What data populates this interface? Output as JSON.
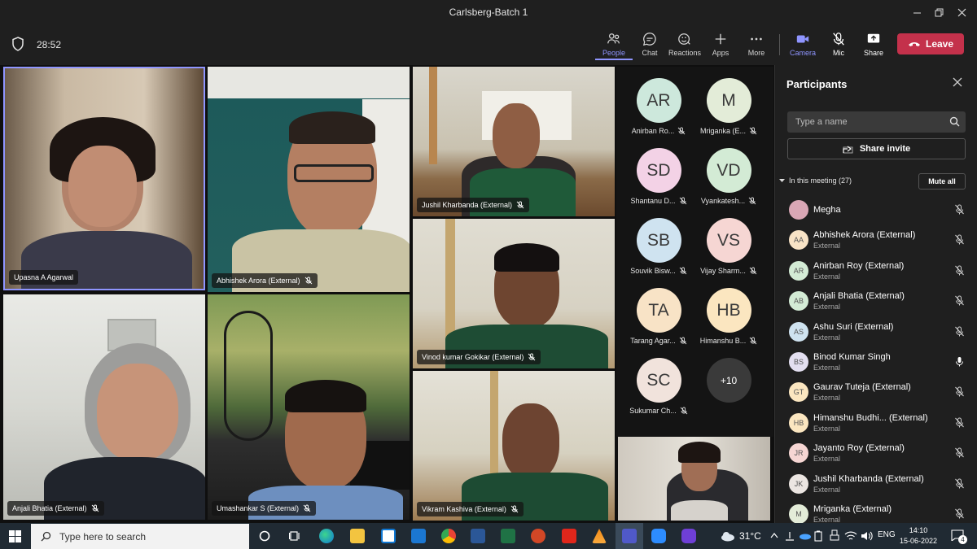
{
  "window": {
    "title": "Carlsberg-Batch 1"
  },
  "toolbar": {
    "timer": "28:52",
    "buttons": {
      "people": "People",
      "chat": "Chat",
      "reactions": "Reactions",
      "apps": "Apps",
      "more": "More",
      "camera": "Camera",
      "mic": "Mic",
      "share": "Share"
    },
    "leave": "Leave"
  },
  "tiles": [
    {
      "name": "Upasna A Agarwal"
    },
    {
      "name": "Abhishek Arora (External)"
    },
    {
      "name": "Jushil Kharbanda (External)"
    },
    {
      "name": "Vinod kumar Gokikar (External)"
    },
    {
      "name": "Anjali Bhatia (External)"
    },
    {
      "name": "Umashankar S (External)"
    },
    {
      "name": "Vikram Kashiva (External)"
    }
  ],
  "avatars": [
    {
      "initials": "AR",
      "name": "Anirban Ro...",
      "color": "#cde8dc"
    },
    {
      "initials": "M",
      "name": "Mriganka (E...",
      "color": "#e3ecd8"
    },
    {
      "initials": "SD",
      "name": "Shantanu D...",
      "color": "#f3d2e6"
    },
    {
      "initials": "VD",
      "name": "Vyankatesh...",
      "color": "#d3ebd5"
    },
    {
      "initials": "SB",
      "name": "Souvik Bisw...",
      "color": "#cfe3f0"
    },
    {
      "initials": "VS",
      "name": "Vijay Sharm...",
      "color": "#f6d6d3"
    },
    {
      "initials": "TA",
      "name": "Tarang Agar...",
      "color": "#f8e3c6"
    },
    {
      "initials": "HB",
      "name": "Himanshu B...",
      "color": "#fbe6c0"
    },
    {
      "initials": "SC",
      "name": "Sukumar Ch...",
      "color": "#f1e3dc"
    }
  ],
  "overflow_count": "+10",
  "panel": {
    "title": "Participants",
    "search_placeholder": "Type a name",
    "share_invite": "Share invite",
    "in_meeting": "In this meeting (27)",
    "mute_all": "Mute all",
    "participants": [
      {
        "initials": "",
        "name": "Megha",
        "tag": "",
        "sub": "",
        "color": "#d9a7b5",
        "mic": "off"
      },
      {
        "initials": "AA",
        "name": "Abhishek Arora",
        "tag": "(External)",
        "sub": "External",
        "color": "#f8e3c6",
        "mic": "off"
      },
      {
        "initials": "AR",
        "name": "Anirban Roy",
        "tag": "(External)",
        "sub": "External",
        "color": "#d3ebd5",
        "mic": "off"
      },
      {
        "initials": "AB",
        "name": "Anjali Bhatia",
        "tag": "(External)",
        "sub": "External",
        "color": "#d3ebd5",
        "mic": "off"
      },
      {
        "initials": "AS",
        "name": "Ashu Suri",
        "tag": "(External)",
        "sub": "External",
        "color": "#cfe3f0",
        "mic": "off"
      },
      {
        "initials": "BS",
        "name": "Binod Kumar Singh",
        "tag": "",
        "sub": "External",
        "color": "#e3dff0",
        "mic": "on"
      },
      {
        "initials": "GT",
        "name": "Gaurav Tuteja",
        "tag": "(External)",
        "sub": "External",
        "color": "#fbe6c0",
        "mic": "off"
      },
      {
        "initials": "HB",
        "name": "Himanshu Budhi...",
        "tag": "(External)",
        "sub": "External",
        "color": "#fbe6c0",
        "mic": "off"
      },
      {
        "initials": "JR",
        "name": "Jayanto Roy",
        "tag": "(External)",
        "sub": "External",
        "color": "#f6d6d3",
        "mic": "off"
      },
      {
        "initials": "JK",
        "name": "Jushil Kharbanda",
        "tag": "(External)",
        "sub": "External",
        "color": "#ece6e2",
        "mic": "off"
      },
      {
        "initials": "M",
        "name": "Mriganka",
        "tag": "(External)",
        "sub": "External",
        "color": "#e3ecd8",
        "mic": "off"
      }
    ]
  },
  "taskbar": {
    "search_placeholder": "Type here to search",
    "weather": "31°C",
    "language": "ENG",
    "time": "14:10",
    "date": "15-06-2022",
    "notifications": "4"
  }
}
